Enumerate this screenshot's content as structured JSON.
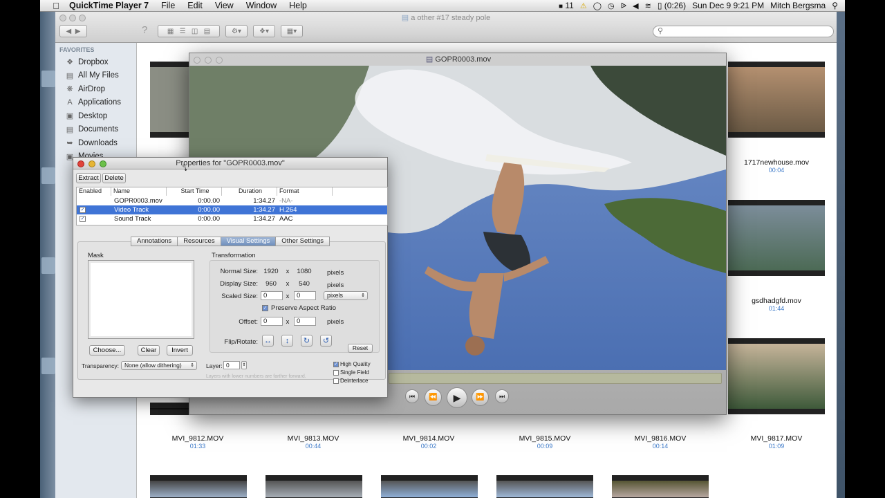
{
  "menubar": {
    "app_name": "QuickTime Player 7",
    "menus": [
      "File",
      "Edit",
      "View",
      "Window",
      "Help"
    ],
    "battery_time": "(0:26)",
    "adobe_count": "11",
    "datetime": "Sun Dec 9  9:21 PM",
    "user": "Mitch Bergsma",
    "icons": [
      "apple-icon",
      "adobe-icon",
      "warning-icon",
      "chat-icon",
      "time-machine-icon",
      "bluetooth-icon",
      "volume-icon",
      "wifi-icon",
      "battery-icon",
      "spotlight-icon"
    ]
  },
  "finder": {
    "title": "a other #17 steady pole",
    "search_placeholder": "",
    "sidebar": {
      "favorites_header": "FAVORITES",
      "items": [
        {
          "label": "Dropbox",
          "icon": "dropbox-icon"
        },
        {
          "label": "All My Files",
          "icon": "all-files-icon"
        },
        {
          "label": "AirDrop",
          "icon": "airdrop-icon"
        },
        {
          "label": "Applications",
          "icon": "applications-icon"
        },
        {
          "label": "Desktop",
          "icon": "desktop-icon"
        },
        {
          "label": "Documents",
          "icon": "documents-icon"
        },
        {
          "label": "Downloads",
          "icon": "downloads-icon"
        },
        {
          "label": "Movies",
          "icon": "movies-icon"
        }
      ]
    },
    "files": [
      {
        "name": "1717newhouse.mov",
        "duration": "00:04"
      },
      {
        "name": "gsdhadgfd.mov",
        "duration": "01:44"
      },
      {
        "name": "MVI_9812.MOV",
        "duration": "01:33"
      },
      {
        "name": "MVI_9813.MOV",
        "duration": "00:44"
      },
      {
        "name": "MVI_9814.MOV",
        "duration": "00:02"
      },
      {
        "name": "MVI_9815.MOV",
        "duration": "00:09"
      },
      {
        "name": "MVI_9816.MOV",
        "duration": "00:14"
      },
      {
        "name": "MVI_9817.MOV",
        "duration": "01:09"
      }
    ]
  },
  "movie_window": {
    "title": "GOPR0003.mov"
  },
  "properties": {
    "title": "Properties for \"GOPR0003.mov\"",
    "extract_label": "Extract",
    "delete_label": "Delete",
    "columns": [
      "Enabled",
      "Name",
      "Start Time",
      "Duration",
      "Format"
    ],
    "tracks": [
      {
        "enabled": "",
        "name": "GOPR0003.mov",
        "start": "0:00.00",
        "duration": "1:34.27",
        "format": "-NA-",
        "selected": false
      },
      {
        "enabled": "✓",
        "name": "Video Track",
        "start": "0:00.00",
        "duration": "1:34.27",
        "format": "H.264",
        "selected": true
      },
      {
        "enabled": "✓",
        "name": "Sound Track",
        "start": "0:00.00",
        "duration": "1:34.27",
        "format": "AAC",
        "selected": false
      }
    ],
    "tabs": [
      "Annotations",
      "Resources",
      "Visual Settings",
      "Other Settings"
    ],
    "selected_tab": "Visual Settings",
    "mask": {
      "label": "Mask",
      "choose_label": "Choose...",
      "clear_label": "Clear",
      "invert_label": "Invert"
    },
    "transparency": {
      "label": "Transparency:",
      "value": "None (allow dithering)"
    },
    "transformation": {
      "label": "Transformation",
      "normal_size_label": "Normal Size:",
      "normal_w": "1920",
      "normal_h": "1080",
      "display_size_label": "Display Size:",
      "display_w": "960",
      "display_h": "540",
      "scaled_size_label": "Scaled Size:",
      "scaled_w": "0",
      "scaled_h": "0",
      "unit": "pixels",
      "unit_select": "pixels",
      "x": "x",
      "preserve_label": "Preserve Aspect Ratio",
      "offset_label": "Offset:",
      "offset_x": "0",
      "offset_y": "0",
      "flip_label": "Flip/Rotate:",
      "reset_label": "Reset"
    },
    "layer": {
      "label": "Layer:",
      "value": "0",
      "hint": "Layers with lower numbers are farther forward."
    },
    "options": {
      "high_quality": "High Quality",
      "single_field": "Single Field",
      "deinterlace": "Deinterlace"
    }
  }
}
